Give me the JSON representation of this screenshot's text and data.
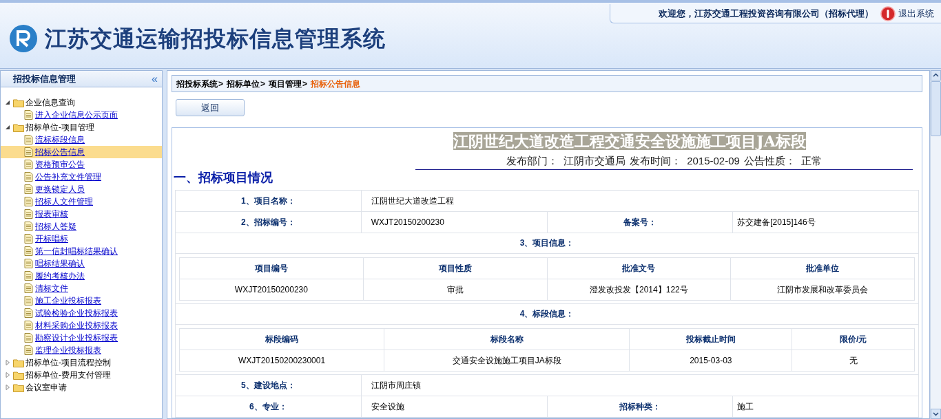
{
  "header": {
    "title": "江苏交通运输招投标信息管理系统",
    "welcome": "欢迎您，江苏交通工程投资咨询有限公司（招标代理）",
    "logout": "退出系统"
  },
  "sidebar": {
    "title": "招投标信息管理",
    "collapse": "«",
    "tree": [
      {
        "label": "企业信息查询",
        "expanded": true,
        "children": [
          {
            "label": "进入企业信息公示页面",
            "selected": false
          }
        ]
      },
      {
        "label": "招标单位-项目管理",
        "expanded": true,
        "children": [
          {
            "label": "流标标段信息",
            "selected": false
          },
          {
            "label": "招标公告信息",
            "selected": true
          },
          {
            "label": "资格预审公告",
            "selected": false
          },
          {
            "label": "公告补充文件管理",
            "selected": false
          },
          {
            "label": "更换锁定人员",
            "selected": false
          },
          {
            "label": "招标人文件管理",
            "selected": false
          },
          {
            "label": "报表审核",
            "selected": false
          },
          {
            "label": "招标人答疑",
            "selected": false
          },
          {
            "label": "开标唱标",
            "selected": false
          },
          {
            "label": "第一信封唱标结果确认",
            "selected": false
          },
          {
            "label": "唱标结果确认",
            "selected": false
          },
          {
            "label": "履约考核办法",
            "selected": false
          },
          {
            "label": "清标文件",
            "selected": false
          },
          {
            "label": "施工企业投标报表",
            "selected": false
          },
          {
            "label": "试验检验企业投标报表",
            "selected": false
          },
          {
            "label": "材料采购企业投标报表",
            "selected": false
          },
          {
            "label": "勘察设计企业投标报表",
            "selected": false
          },
          {
            "label": "监理企业投标报表",
            "selected": false
          }
        ]
      },
      {
        "label": "招标单位-项目流程控制",
        "expanded": false
      },
      {
        "label": "招标单位-费用支付管理",
        "expanded": false
      },
      {
        "label": "会议室申请",
        "expanded": false
      }
    ]
  },
  "breadcrumb": {
    "separator": ">",
    "items": [
      "招投标系统",
      "招标单位",
      "项目管理",
      "招标公告信息"
    ]
  },
  "back_button": "返回",
  "notice": {
    "title": "江阴世纪大道改造工程交通安全设施施工项目JA标段",
    "meta": [
      {
        "label": "发布部门：",
        "value": "江阴市交通局"
      },
      {
        "label": "发布时间：",
        "value": "2015-02-09"
      },
      {
        "label": "公告性质：",
        "value": "正常"
      }
    ],
    "section_heading": "一、招标项目情况",
    "rows": [
      {
        "kind": "pair",
        "label": "1、项目名称：",
        "value": "江阴世纪大道改造工程"
      },
      {
        "kind": "double",
        "label": "2、招标编号：",
        "value": "WXJT20150200230",
        "label2": "备案号：",
        "value2": "苏交建备[2015]146号"
      },
      {
        "kind": "subheading",
        "label": "3、项目信息："
      },
      {
        "kind": "evengrid",
        "columns": [
          "项目编号",
          "项目性质",
          "批准文号",
          "批准单位"
        ],
        "rows": [
          [
            "WXJT20150200230",
            "审批",
            "澄发改投发【2014】122号",
            "江阴市发展和改革委员会"
          ]
        ]
      },
      {
        "kind": "subheading",
        "label": "4、标段信息："
      },
      {
        "kind": "widegrid",
        "columns": [
          "标段编码",
          "标段名称",
          "投标截止时间",
          "限价/元"
        ],
        "rows": [
          [
            "WXJT20150200230001",
            "交通安全设施施工项目JA标段",
            "2015-03-03",
            "无"
          ]
        ]
      },
      {
        "kind": "pair",
        "label": "5、建设地点：",
        "value": "江阴市周庄镇"
      },
      {
        "kind": "double",
        "label": "6、专业：",
        "value": "安全设施",
        "label2": "招标种类：",
        "value2": "施工"
      }
    ]
  }
}
